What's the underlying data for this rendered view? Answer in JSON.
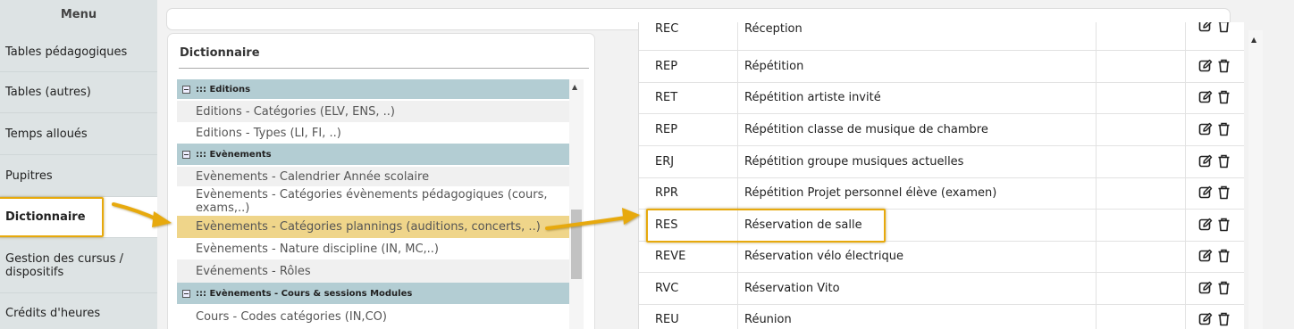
{
  "sidebar": {
    "title": "Menu",
    "items": [
      {
        "label": "Tables pédagogiques"
      },
      {
        "label": "Tables (autres)"
      },
      {
        "label": "Temps alloués"
      },
      {
        "label": "Pupitres"
      },
      {
        "label": "Dictionnaire"
      },
      {
        "label": "Gestion des cursus / dispositifs"
      },
      {
        "label": "Crédits d'heures"
      }
    ]
  },
  "dictionary": {
    "title": "Dictionnaire",
    "groups": [
      {
        "label": "::: Editions"
      },
      {
        "label": "::: Evènements"
      },
      {
        "label": "::: Evènements - Cours & sessions Modules"
      }
    ],
    "entries": [
      {
        "label": "Editions - Catégories (ELV, ENS, ..)"
      },
      {
        "label": "Editions - Types (LI, FI, ..)"
      },
      {
        "label": "Evènements - Calendrier Année scolaire"
      },
      {
        "label": "Evènements - Catégories évènements pédagogiques (cours, exams,..)"
      },
      {
        "label": "Evènements - Catégories plannings (auditions, concerts, ..)"
      },
      {
        "label": "Evènements - Nature discipline (IN, MC,..)"
      },
      {
        "label": "Evénements - Rôles"
      },
      {
        "label": "Cours - Codes catégories (IN,CO)"
      }
    ]
  },
  "table": {
    "rows": [
      {
        "code": "REC",
        "label": "Réception"
      },
      {
        "code": "REP",
        "label": "Répétition"
      },
      {
        "code": "RET",
        "label": "Répétition artiste invité"
      },
      {
        "code": "REP",
        "label": "Répétition classe de musique de chambre"
      },
      {
        "code": "ERJ",
        "label": "Répétition groupe musiques actuelles"
      },
      {
        "code": "RPR",
        "label": "Répétition Projet personnel élève (examen)"
      },
      {
        "code": "RES",
        "label": "Réservation de salle"
      },
      {
        "code": "REVE",
        "label": "Réservation vélo électrique"
      },
      {
        "code": "RVC",
        "label": "Réservation Vito"
      },
      {
        "code": "REU",
        "label": "Réunion"
      }
    ]
  },
  "colors": {
    "highlight": "#e7a90c",
    "selected_row": "#efd58a",
    "group_header": "#b3cdd3",
    "sidebar_bg": "#dde3e4"
  }
}
